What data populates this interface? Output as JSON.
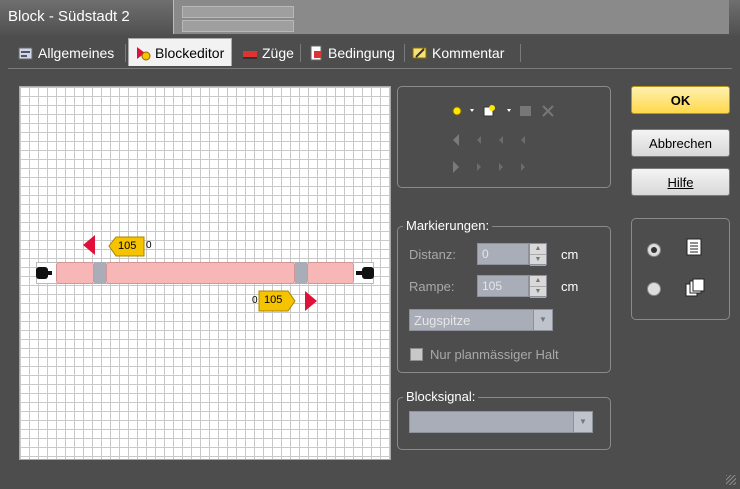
{
  "window": {
    "title": "Block - Südstadt 2"
  },
  "tabs": [
    {
      "label": "Allgemeines",
      "icon": "settings-icon"
    },
    {
      "label": "Blockeditor",
      "icon": "block-editor-icon",
      "active": true
    },
    {
      "label": "Züge",
      "icon": "train-icon"
    },
    {
      "label": "Bedingung",
      "icon": "condition-icon"
    },
    {
      "label": "Kommentar",
      "icon": "comment-icon"
    }
  ],
  "editor": {
    "marker_left": {
      "value": "105",
      "offset": "0"
    },
    "marker_right": {
      "value": "105",
      "offset": "0"
    }
  },
  "markierungen": {
    "legend": "Markierungen:",
    "distanz_label": "Distanz:",
    "distanz_value": "0",
    "rampe_label": "Rampe:",
    "rampe_value": "105",
    "unit": "cm",
    "train_select": "Zugspitze",
    "checkbox_label": "Nur planmässiger Halt"
  },
  "blocksignal": {
    "legend": "Blocksignal:",
    "value": ""
  },
  "buttons": {
    "ok": "OK",
    "cancel": "Abbrechen",
    "help": "Hilfe"
  },
  "colors": {
    "track_segment": "#f7b7b7",
    "marker": "#f6c300",
    "flag": "#e0103a",
    "ok_button": "#ffd84a"
  }
}
